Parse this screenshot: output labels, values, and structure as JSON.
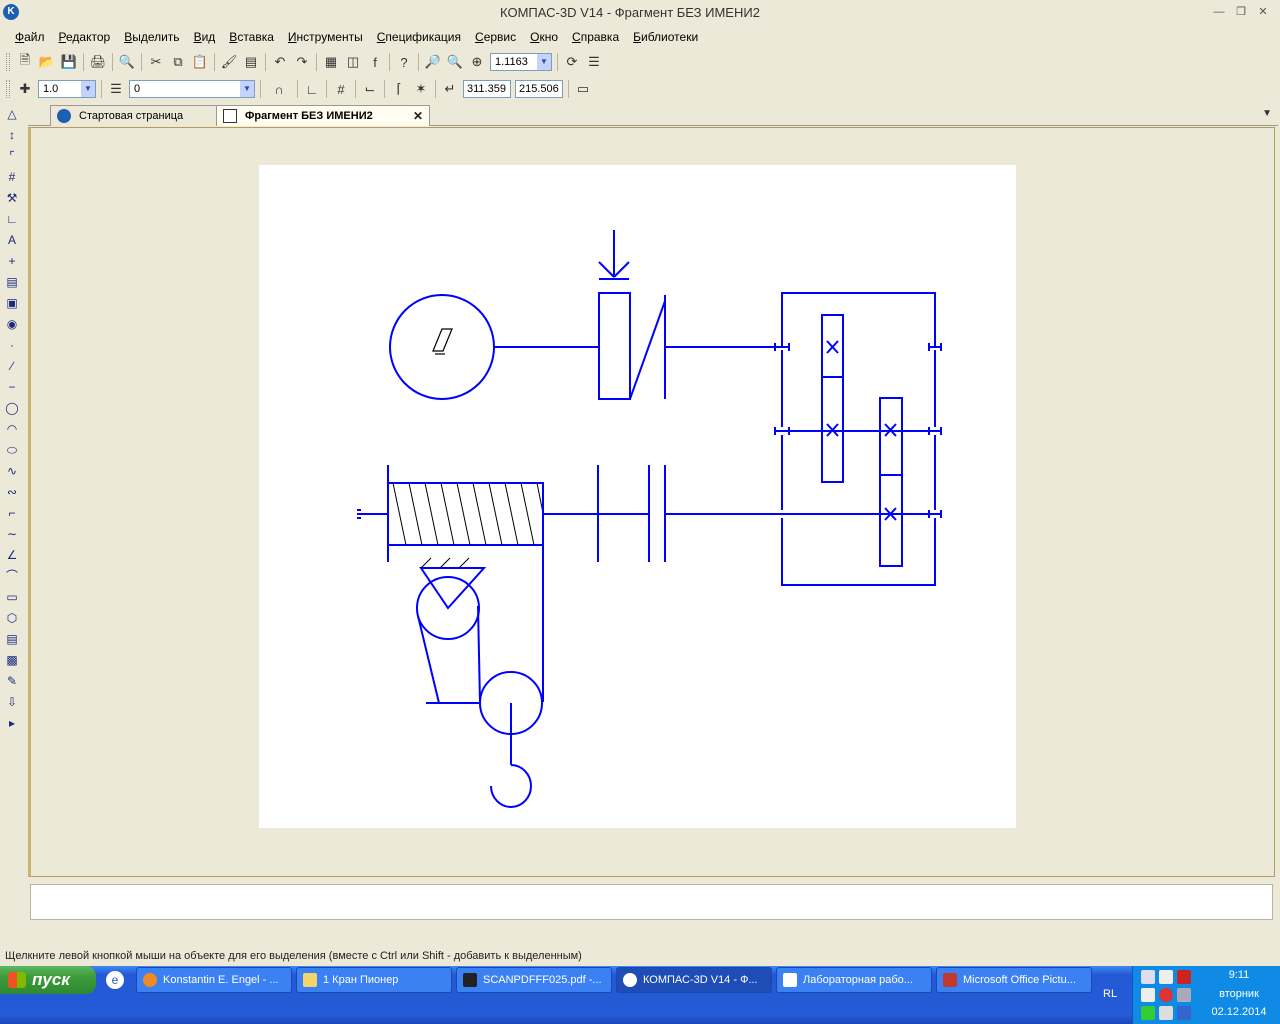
{
  "window": {
    "title": "КОМПАС-3D V14 - Фрагмент БЕЗ ИМЕНИ2"
  },
  "menu": [
    "Файл",
    "Редактор",
    "Выделить",
    "Вид",
    "Вставка",
    "Инструменты",
    "Спецификация",
    "Сервис",
    "Окно",
    "Справка",
    "Библиотеки"
  ],
  "toolbar": {
    "zoom_value": "1.1163",
    "step_value": "1.0",
    "layer_value": "0",
    "coord_x": "311.359",
    "coord_y": "215.506"
  },
  "tabs": {
    "start_page": "Стартовая страница",
    "fragment": "Фрагмент БЕЗ ИМЕНИ2"
  },
  "drawing": {
    "motor_label": "Д"
  },
  "status": {
    "hint": "Щелкните левой кнопкой мыши на объекте для его выделения (вместе с Ctrl или Shift - добавить к выделенным)"
  },
  "taskbar": {
    "start": "пуск",
    "items": [
      "Konstantin E. Engel - ...",
      "1 Кран Пионер",
      "SCANPDFFF025.pdf -...",
      "КОМПАС-3D V14 - Ф...",
      "Лабораторная рабо...",
      "Microsoft Office Pictu..."
    ],
    "lang": "RL",
    "time": "9:11",
    "weekday": "вторник",
    "date": "02.12.2014"
  },
  "colors": {
    "drawing": "#0000ff",
    "taskbar": "#245bd6",
    "canvas_bg": "#ece9d8"
  }
}
